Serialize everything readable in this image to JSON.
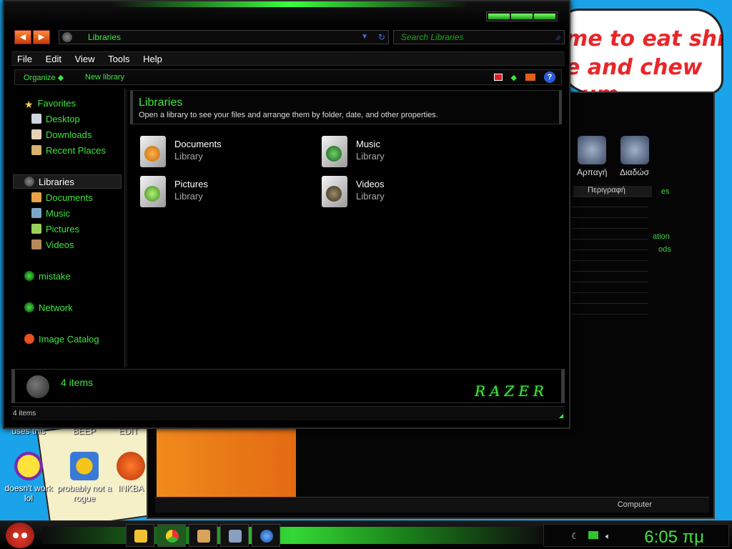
{
  "wallpaper": {
    "bubble_lines": [
      "me to eat shit",
      "e and chew",
      "gum"
    ]
  },
  "desktop_icons": [
    {
      "label": "uses this",
      "icon": "doc-icon"
    },
    {
      "label": "BEEP",
      "icon": "doc-icon"
    },
    {
      "label": "EDIT",
      "icon": "doc-icon"
    },
    {
      "label": "doesn't work lol",
      "icon": "yahoo-messenger-icon"
    },
    {
      "label": "probably not a rogue",
      "icon": "gear-settings-icon"
    },
    {
      "label": "INKBA",
      "icon": "paint-icon"
    }
  ],
  "back_window": {
    "toolbar": [
      "Αρπαγή",
      "Διαδώσ"
    ],
    "column_header": "Περιγραφή",
    "green_snippets": [
      "es",
      "ation",
      "ods"
    ],
    "status": "Computer"
  },
  "window": {
    "address": "Libraries",
    "search_placeholder": "Search Libraries",
    "menu": [
      "File",
      "Edit",
      "View",
      "Tools",
      "Help"
    ],
    "commands": {
      "organize": "Organize",
      "new_library": "New library"
    },
    "nav": {
      "favorites": "Favorites",
      "favorites_items": [
        "Desktop",
        "Downloads",
        "Recent Places"
      ],
      "libraries": "Libraries",
      "library_items": [
        "Documents",
        "Music",
        "Pictures",
        "Videos"
      ],
      "homegroup": "mistake",
      "network": "Network",
      "image_catalog": "Image Catalog"
    },
    "content": {
      "title": "Libraries",
      "subtitle": "Open a library to see your files and arrange them by folder, date, and other properties.",
      "libraries": [
        {
          "name": "Documents",
          "type": "Library"
        },
        {
          "name": "Music",
          "type": "Library"
        },
        {
          "name": "Pictures",
          "type": "Library"
        },
        {
          "name": "Videos",
          "type": "Library"
        }
      ]
    },
    "details": {
      "count": "4 items",
      "brand": "RAZER"
    },
    "status": "4 items"
  },
  "taskbar": {
    "clock": "6:05 πμ",
    "buttons": [
      "explorer-icon",
      "chrome-icon",
      "media-icon",
      "control-panel-icon",
      "ie-icon"
    ]
  },
  "colors": {
    "accent_green": "#3ee53e",
    "background": "#000000",
    "desktop": "#1aa3e8"
  }
}
